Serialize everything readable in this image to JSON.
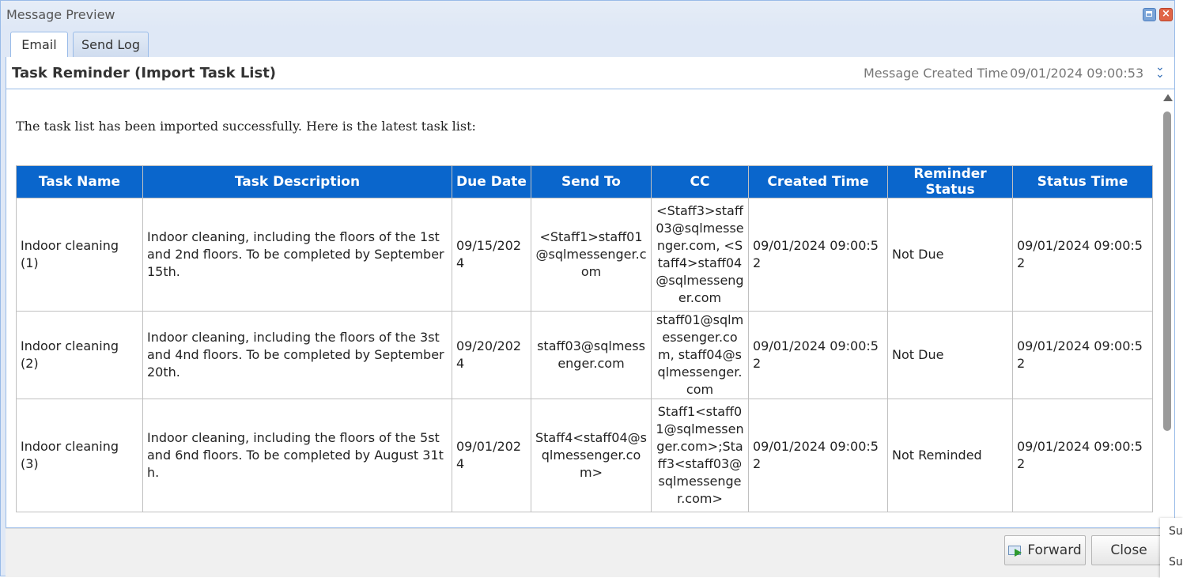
{
  "window": {
    "title": "Message Preview"
  },
  "tabs": [
    {
      "label": "Email"
    },
    {
      "label": "Send Log"
    }
  ],
  "message": {
    "subject": "Task Reminder (Import Task List)",
    "created_label": "Message Created Time",
    "created_value": "09/01/2024 09:00:53",
    "intro": "The task list has been imported successfully. Here is the latest task list:"
  },
  "table": {
    "headers": [
      "Task Name",
      "Task Description",
      "Due Date",
      "Send To",
      "CC",
      "Created Time",
      "Reminder Status",
      "Status Time"
    ],
    "rows": [
      [
        "Indoor cleaning (1)",
        "Indoor cleaning, including the floors of the 1st and 2nd floors. To be completed by September 15th.",
        "09/15/2024",
        "<Staff1>staff01@sqlmessenger.com",
        "<Staff3>staff03@sqlmessenger.com, <Staff4>staff04@sqlmessenger.com",
        "09/01/2024 09:00:52",
        "Not Due",
        "09/01/2024 09:00:52"
      ],
      [
        "Indoor cleaning (2)",
        "Indoor cleaning, including the floors of the 3st and 4nd floors. To be completed by September 20th.",
        "09/20/2024",
        "staff03@sqlmessenger.com",
        "staff01@sqlmessenger.com, staff04@sqlmessenger.com",
        "09/01/2024 09:00:52",
        "Not Due",
        "09/01/2024 09:00:52"
      ],
      [
        "Indoor cleaning (3)",
        "Indoor cleaning, including the floors of the 5st and 6nd floors. To be completed by August 31th.",
        "09/01/2024",
        "Staff4<staff04@sqlmessenger.com>",
        "Staff1<staff01@sqlmessenger.com>;Staff3<staff03@sqlmessenger.com>",
        "09/01/2024 09:00:52",
        "Not Reminded",
        "09/01/2024 09:00:52"
      ]
    ]
  },
  "footer": {
    "forward_label": "Forward",
    "close_label": "Close"
  },
  "side_fragment": [
    "Su",
    "Su"
  ],
  "icons": {
    "maximize": "maximize-icon",
    "close": "close-icon",
    "expand": "double-chevron-down-icon",
    "forward": "forward-mail-icon"
  }
}
